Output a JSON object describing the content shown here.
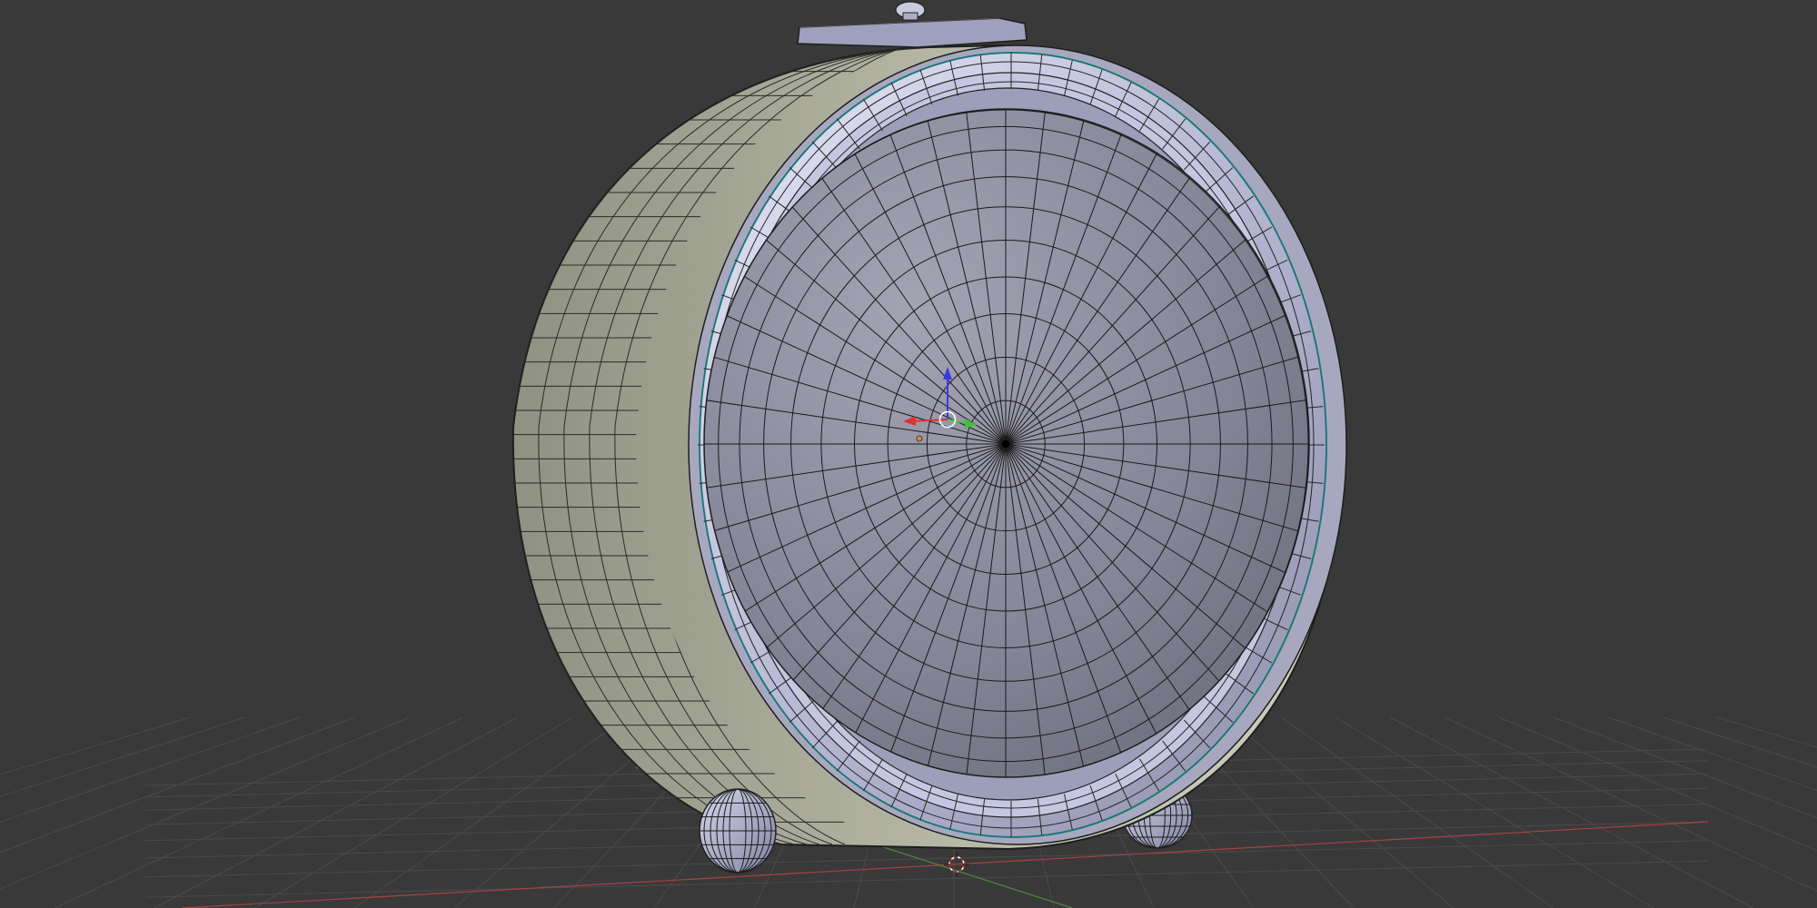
{
  "viewport": {
    "background_color": "#393939",
    "grid_line_color": "#4a4a4a",
    "x_axis_color": "#a8413f",
    "y_axis_color": "#4f8a3c"
  },
  "object": {
    "type": "clock-mesh",
    "display_mode": "solid-with-wireframe",
    "selected": false,
    "wire_color": "#000000",
    "edge_highlight_color": "#1a8a8a",
    "rim_color": "#c7c8e6",
    "bezel_side_color": "#b6b6a6",
    "face_color": "#8c8c9e"
  },
  "transform_gizmo": {
    "x_axis_color": "#e03030",
    "y_axis_color": "#3fc43f",
    "z_axis_color": "#3a3ae0",
    "pivot_icon": "circle-pivot-icon"
  },
  "origin_dot_color": "#e88a24",
  "cursor_3d": {
    "icon": "3d-cursor-icon",
    "ring_colors": [
      "#d02a2a",
      "#ffffff"
    ]
  }
}
